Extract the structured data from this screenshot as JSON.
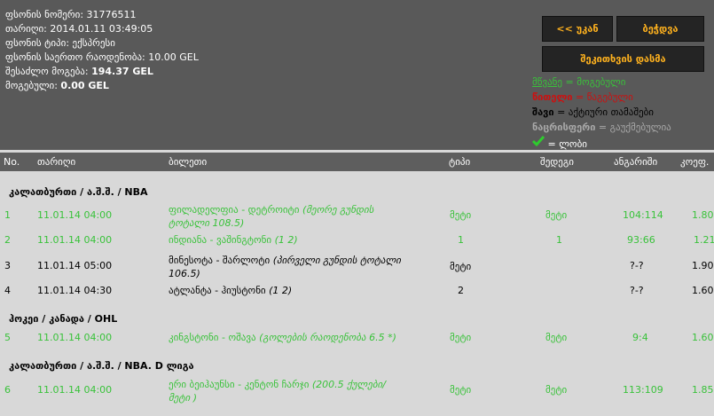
{
  "ticket_info": [
    {
      "label": "ფსონის ნომერი:",
      "value": "31776511",
      "bold": false
    },
    {
      "label": "თარიღი:",
      "value": "2014.01.11 03:49:05",
      "bold": false
    },
    {
      "label": "ფსონის ტიპი:",
      "value": "ექსპრესი",
      "bold": false
    },
    {
      "label": "ფსონის საერთო რაოდენობა:",
      "value": "10.00 GEL",
      "bold": false
    },
    {
      "label": "შესაძლო მოგება:",
      "value": "194.37 GEL",
      "bold": true
    },
    {
      "label": "მოგებული:",
      "value": "0.00 GEL",
      "bold": true
    }
  ],
  "buttons": {
    "back": "<< უკან",
    "print": "ბეჭდვა",
    "place_bet": "შეკითხვის დასმა"
  },
  "legend": {
    "green": {
      "key": "მწვანე",
      "text": "მოგებული"
    },
    "red": {
      "key": "წითელი",
      "text": "წაგებული"
    },
    "black": {
      "key": "შავი",
      "text": "აქტიური თამაშები"
    },
    "gray": {
      "key": "ნაცრისფერი",
      "text": "გაუქმებულია"
    },
    "check": {
      "text": "= ლობი",
      "icon": "check-icon"
    }
  },
  "columns": [
    "No.",
    "თარიღი",
    "ბილეთი",
    "ტიპი",
    "შედეგი",
    "ანგარიში",
    "კოეფ."
  ],
  "groups": [
    {
      "title": "კალათბურთი / ა.შ.შ. / NBA",
      "rows": [
        {
          "no": "1",
          "date": "11.01.14 04:00",
          "event": "ფილადელფია - დეტროიტი",
          "detail": "(მეორე გუნდის ტოტალი 108.5)",
          "type": "მეტი",
          "result": "მეტი",
          "score": "104:114",
          "odds": "1.80",
          "status": "won"
        },
        {
          "no": "2",
          "date": "11.01.14 04:00",
          "event": "ინდიანა - ვაშინგტონი",
          "detail": "(1 2)",
          "type": "1",
          "result": "1",
          "score": "93:66",
          "odds": "1.21",
          "status": "won"
        },
        {
          "no": "3",
          "date": "11.01.14 05:00",
          "event": "მინესოტა - შარლოტი",
          "detail": "(პირველი გუნდის ტოტალი 106.5)",
          "type": "მეტი",
          "result": "",
          "score": "?-?",
          "odds": "1.90",
          "status": "active"
        },
        {
          "no": "4",
          "date": "11.01.14 04:30",
          "event": "ატლანტა - ჰიუსტონი",
          "detail": "(1 2)",
          "type": "2",
          "result": "",
          "score": "?-?",
          "odds": "1.60",
          "status": "active"
        }
      ]
    },
    {
      "title": "ჰოკეი / კანადა / OHL",
      "rows": [
        {
          "no": "5",
          "date": "11.01.14 04:00",
          "event": "კინგსტონი - ოშავა",
          "detail": "(გოლების რაოდენობა 6.5 *)",
          "type": "მეტი",
          "result": "მეტი",
          "score": "9:4",
          "odds": "1.60",
          "status": "won"
        }
      ]
    },
    {
      "title": "კალათბურთი / ა.შ.შ. / NBA. D ლიგა",
      "rows": [
        {
          "no": "6",
          "date": "11.01.14 04:00",
          "event": "ერი ბეიჰაუნსი - კენტონ ჩარჯი",
          "detail": "(200.5 ქულები/ მეტი )",
          "type": "მეტი",
          "result": "მეტი",
          "score": "113:109",
          "odds": "1.85",
          "status": "won"
        }
      ]
    }
  ],
  "colors": {
    "won": "#39c23a",
    "lost": "#cc1010",
    "active": "#000000",
    "cancelled": "#a8a8a8",
    "button_text": "#ffb21e",
    "header_bg": "#595959"
  }
}
